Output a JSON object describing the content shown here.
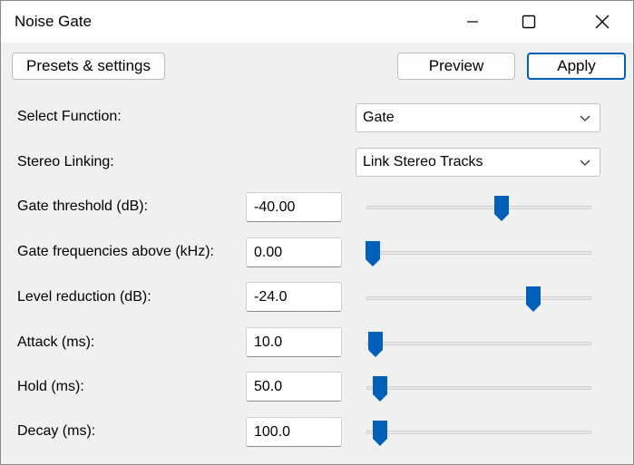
{
  "window": {
    "title": "Noise Gate"
  },
  "toolbar": {
    "presets_label": "Presets & settings",
    "preview_label": "Preview",
    "apply_label": "Apply"
  },
  "function_select": {
    "label": "Select Function:",
    "value": "Gate"
  },
  "stereo_select": {
    "label": "Stereo Linking:",
    "value": "Link Stereo Tracks"
  },
  "params": [
    {
      "label": "Gate threshold (dB):",
      "value": "-40.00",
      "slider_fraction": 0.6
    },
    {
      "label": "Gate frequencies above (kHz):",
      "value": "0.00",
      "slider_fraction": 0.03
    },
    {
      "label": "Level reduction (dB):",
      "value": "-24.0",
      "slider_fraction": 0.74
    },
    {
      "label": "Attack (ms):",
      "value": "10.0",
      "slider_fraction": 0.04
    },
    {
      "label": "Hold (ms):",
      "value": "50.0",
      "slider_fraction": 0.06
    },
    {
      "label": "Decay (ms):",
      "value": "100.0",
      "slider_fraction": 0.06
    }
  ],
  "colors": {
    "accent": "#005fb8",
    "track": "#e6e6e6"
  }
}
